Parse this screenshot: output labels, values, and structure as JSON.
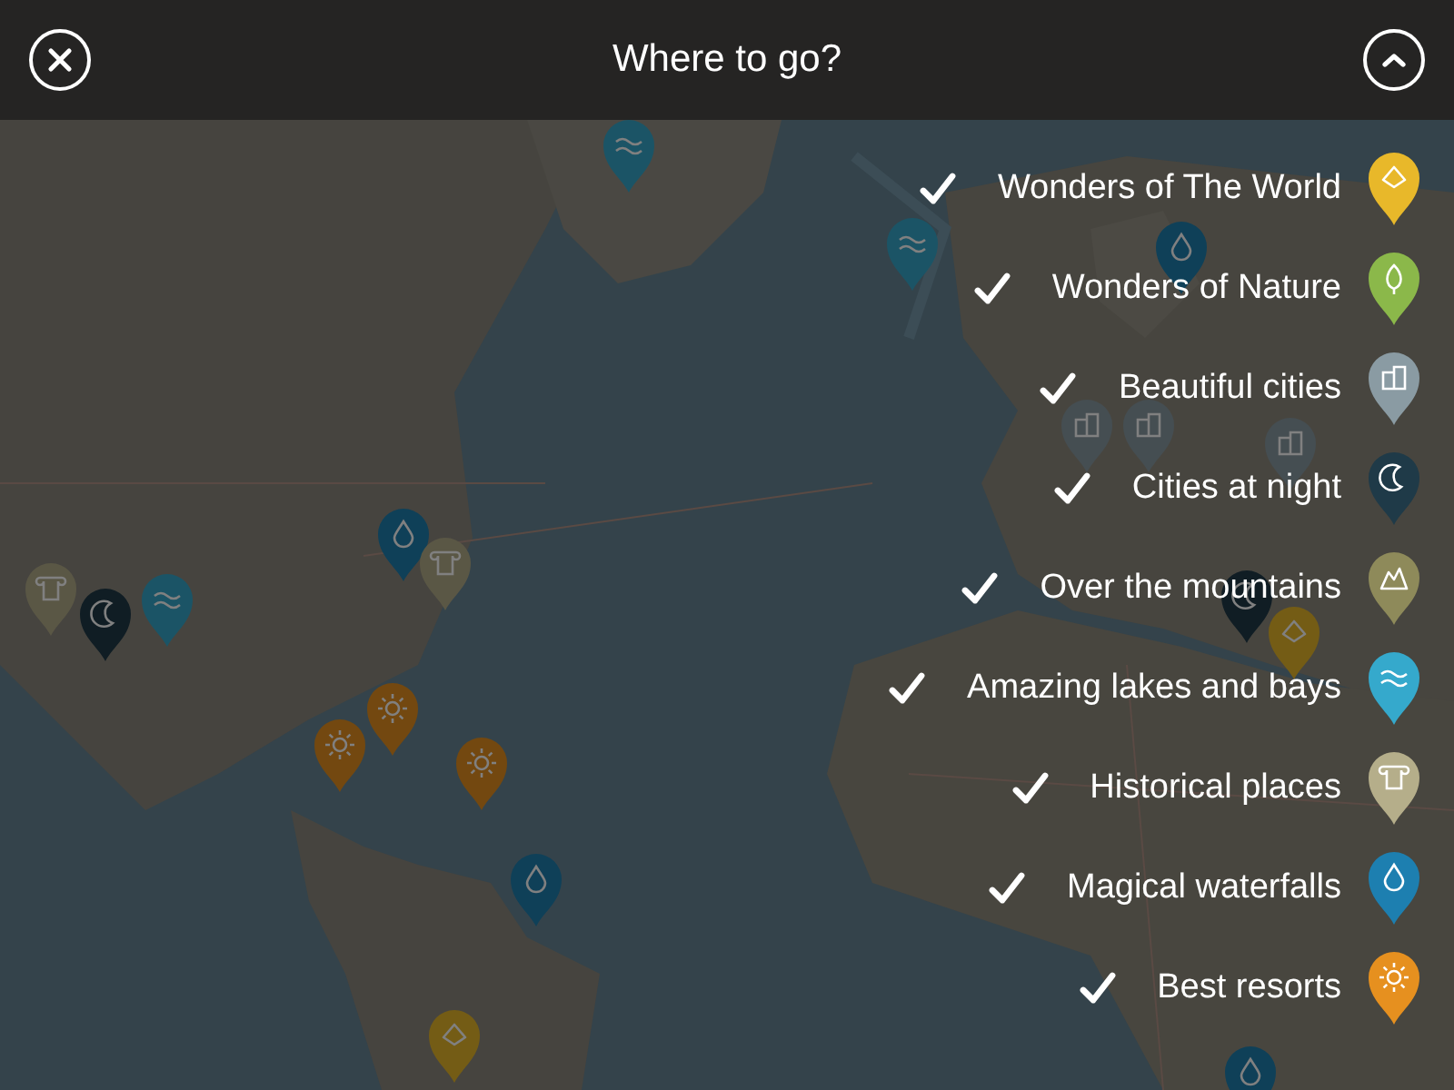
{
  "header": {
    "title": "Where to go?"
  },
  "categories": [
    {
      "label": "Wonders of The World",
      "checked": true,
      "color": "#e8b82a",
      "kind": "world"
    },
    {
      "label": "Wonders of Nature",
      "checked": true,
      "color": "#8bb84a",
      "kind": "nature"
    },
    {
      "label": "Beautiful cities",
      "checked": true,
      "color": "#8a9ba3",
      "kind": "cities"
    },
    {
      "label": "Cities at night",
      "checked": true,
      "color": "#1f3a48",
      "kind": "night"
    },
    {
      "label": "Over the mountains",
      "checked": true,
      "color": "#8e8a5a",
      "kind": "mountains"
    },
    {
      "label": "Amazing lakes and bays",
      "checked": true,
      "color": "#35a9cc",
      "kind": "lakes"
    },
    {
      "label": "Historical places",
      "checked": true,
      "color": "#b5ae8a",
      "kind": "historical"
    },
    {
      "label": "Magical waterfalls",
      "checked": true,
      "color": "#1d7fb0",
      "kind": "waterfalls"
    },
    {
      "label": "Best resorts",
      "checked": true,
      "color": "#e6901f",
      "kind": "resorts"
    }
  ]
}
